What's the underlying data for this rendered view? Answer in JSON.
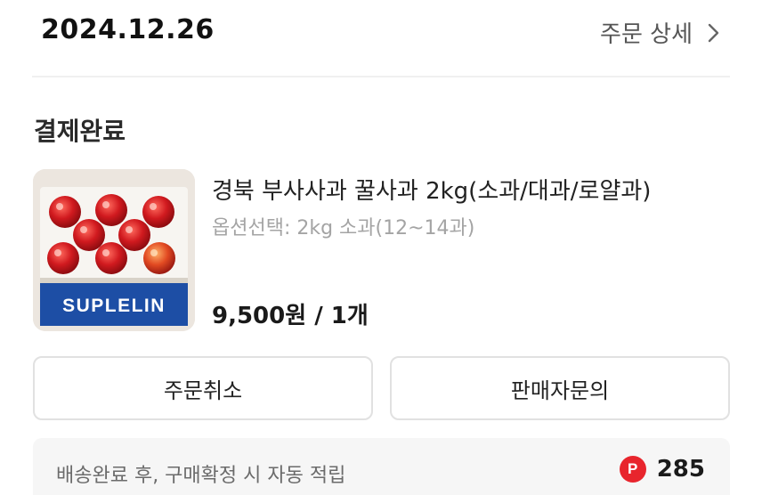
{
  "header": {
    "order_date": "2024.12.26",
    "detail_link_label": "주문 상세"
  },
  "order": {
    "status": "결제완료",
    "product": {
      "name": "경북 부사사과 꿀사과 2kg(소과/대과/로얄과)",
      "option": "옵션선택: 2kg 소과(12~14과)",
      "price": "9,500원 / 1개",
      "thumbnail_brand": "SUPLELIN"
    }
  },
  "actions": {
    "cancel_label": "주문취소",
    "inquiry_label": "판매자문의"
  },
  "points": {
    "description": "배송완료 후, 구매확정 시 자동 적립",
    "badge": "P",
    "value": "285"
  },
  "colors": {
    "accent_red": "#e8252d",
    "apple_red": "#c8151d",
    "box_blue": "#1d4ea5"
  }
}
